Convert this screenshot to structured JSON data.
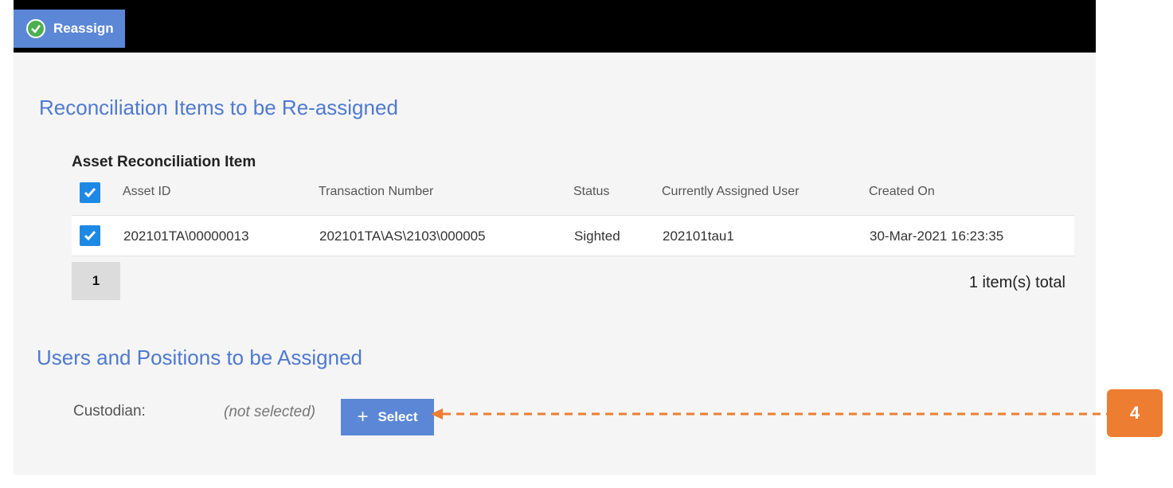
{
  "toolbar": {
    "reassign_label": "Reassign"
  },
  "section1": {
    "title": "Reconciliation Items to be Re-assigned",
    "group_title": "Asset Reconciliation Item",
    "columns": [
      "Asset ID",
      "Transaction Number",
      "Status",
      "Currently Assigned User",
      "Created On"
    ],
    "rows": [
      {
        "checked": true,
        "asset_id": "202101TA\\00000013",
        "transaction_number": "202101TA\\AS\\2103\\000005",
        "status": "Sighted",
        "assigned_user": "202101tau1",
        "created_on": "30-Mar-2021 16:23:35"
      }
    ],
    "select_all_checked": true,
    "page": "1",
    "total": "1 item(s) total"
  },
  "section2": {
    "title": "Users and Positions to be Assigned",
    "custodian_label": "Custodian:",
    "custodian_value": "(not selected)",
    "select_label": "Select"
  },
  "callout": {
    "number": "4",
    "color": "#ed7d31"
  },
  "colors": {
    "accent": "#5b87d6",
    "title": "#4f7ad0",
    "checkbox": "#1e88e5"
  }
}
